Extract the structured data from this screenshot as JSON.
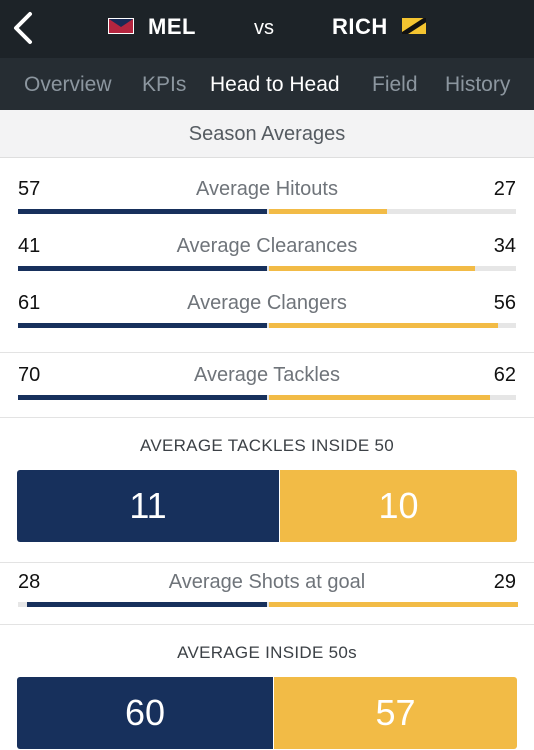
{
  "header": {
    "back_icon": "chevron-left-icon",
    "home_team": "MEL",
    "vs": "vs",
    "away_team": "RICH",
    "colors": {
      "home": "#17305c",
      "away": "#f2bb46",
      "topbar": "#1d2328"
    }
  },
  "tabs": [
    {
      "label": "Overview",
      "active": false
    },
    {
      "label": "KPIs",
      "active": false
    },
    {
      "label": "Head to Head",
      "active": true
    },
    {
      "label": "Field",
      "active": false
    },
    {
      "label": "History",
      "active": false
    }
  ],
  "section_title": "Season Averages",
  "stats": [
    {
      "label": "Average Hitouts",
      "home": "57",
      "away": "27"
    },
    {
      "label": "Average Clearances",
      "home": "41",
      "away": "34"
    },
    {
      "label": "Average Clangers",
      "home": "61",
      "away": "56"
    },
    {
      "label": "Average Tackles",
      "home": "70",
      "away": "62"
    },
    {
      "label": "Average Shots at goal",
      "home": "28",
      "away": "29"
    }
  ],
  "tackles_inside_50": {
    "title": "AVERAGE TACKLES INSIDE 50",
    "home": "11",
    "away": "10"
  },
  "inside_50s": {
    "title": "AVERAGE INSIDE 50s",
    "home": "60",
    "away": "57"
  }
}
